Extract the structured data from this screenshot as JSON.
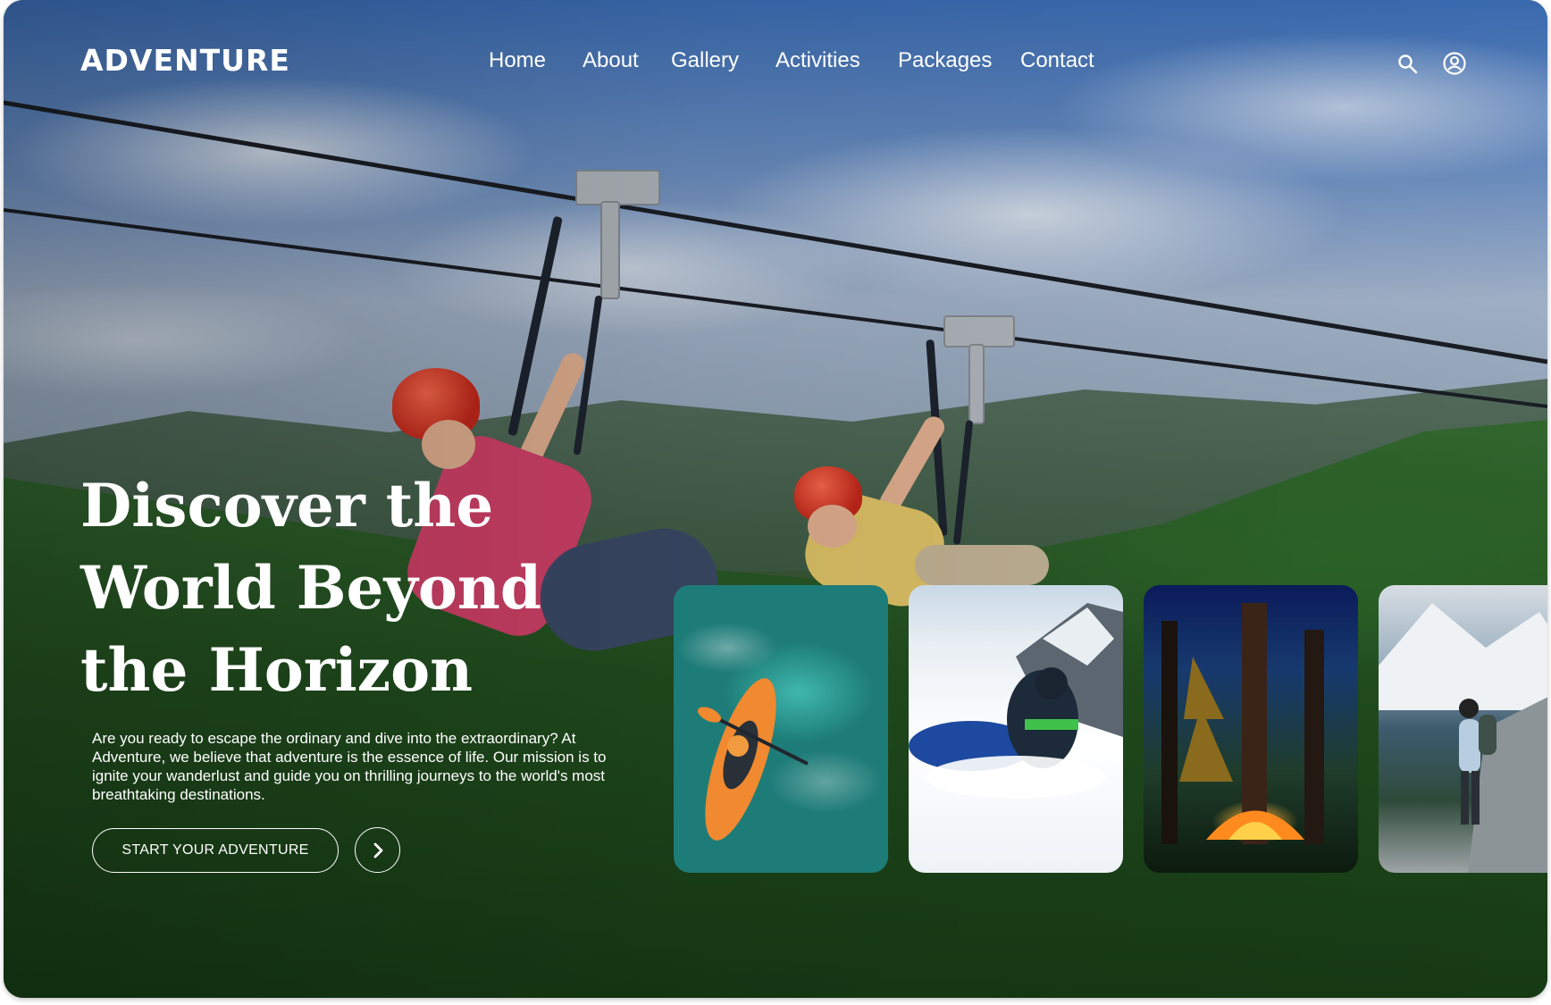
{
  "brand": {
    "logo": "ADVENTURE"
  },
  "nav": {
    "items": [
      "Home",
      "About",
      "Gallery",
      "Activities",
      "Packages",
      "Contact"
    ],
    "search_icon": "search-icon",
    "account_icon": "user-circle-icon"
  },
  "hero": {
    "title_lines": [
      "Discover the",
      "World Beyond",
      "the Horizon"
    ],
    "description": "Are you ready to escape the ordinary and dive into the extraordinary? At Adventure, we believe that adventure is the essence of life. Our mission is to ignite your wanderlust and guide you on thrilling journeys to the world's most breathtaking destinations.",
    "cta_label": "START YOUR ADVENTURE",
    "cta_arrow_icon": "chevron-right-icon"
  },
  "cards": [
    "kayaking",
    "snowmobiling",
    "camping",
    "hiking"
  ],
  "colors": {
    "text": "#ffffff",
    "helmet": "#d8342a"
  }
}
